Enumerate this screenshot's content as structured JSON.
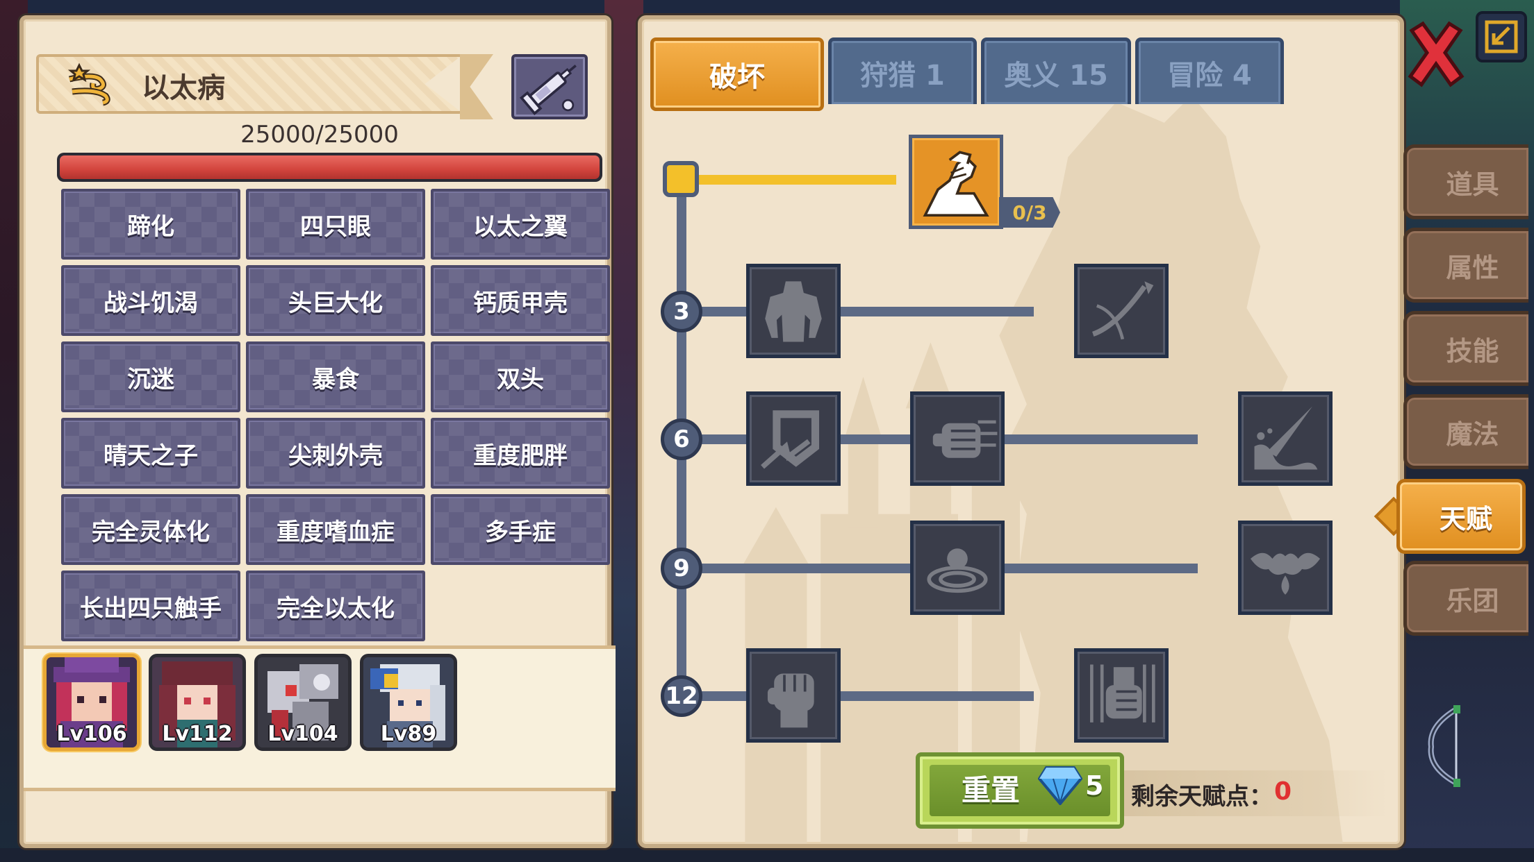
{
  "left_panel": {
    "title": "以太病",
    "hp": "25000/25000",
    "hp_fraction": 1.0,
    "traits": [
      "蹄化",
      "四只眼",
      "以太之翼",
      "战斗饥渴",
      "头巨大化",
      "钙质甲壳",
      "沉迷",
      "暴食",
      "双头",
      "晴天之子",
      "尖刺外壳",
      "重度肥胖",
      "完全灵体化",
      "重度嗜血症",
      "多手症",
      "长出四只触手",
      "完全以太化"
    ],
    "party": [
      {
        "level": "Lv106",
        "selected": true
      },
      {
        "level": "Lv112",
        "selected": false
      },
      {
        "level": "Lv104",
        "selected": false
      },
      {
        "level": "Lv89",
        "selected": false
      }
    ]
  },
  "talent_panel": {
    "tabs": [
      {
        "label": "破坏",
        "active": true
      },
      {
        "label": "狩猎 1",
        "active": false
      },
      {
        "label": "奥义 15",
        "active": false
      },
      {
        "label": "冒险 4",
        "active": false
      }
    ],
    "tiers": [
      "3",
      "6",
      "9",
      "12"
    ],
    "first_node": {
      "icon": "arm-wrestle-icon",
      "count": "0/3"
    },
    "nodes": [
      "muscle-body-icon",
      "arrow-slash-icon",
      "shield-break-icon",
      "fist-dash-icon",
      "blood-slash-icon",
      "ripple-icon",
      "bat-drop-icon",
      "fist-icon",
      "fist-strike-icon"
    ],
    "reset": {
      "label": "重置",
      "cost": "5"
    },
    "remaining_points": {
      "label": "剩余天赋点：",
      "value": "0"
    }
  },
  "side_menu": {
    "items": [
      "道具",
      "属性",
      "技能",
      "魔法",
      "天赋",
      "乐团"
    ],
    "active": "天赋"
  },
  "colors": {
    "accent_orange": "#e59326",
    "trait_purple": "#625f83",
    "hp_red": "#d2443d",
    "reset_green": "#82a73b",
    "points_red": "#e03131"
  }
}
